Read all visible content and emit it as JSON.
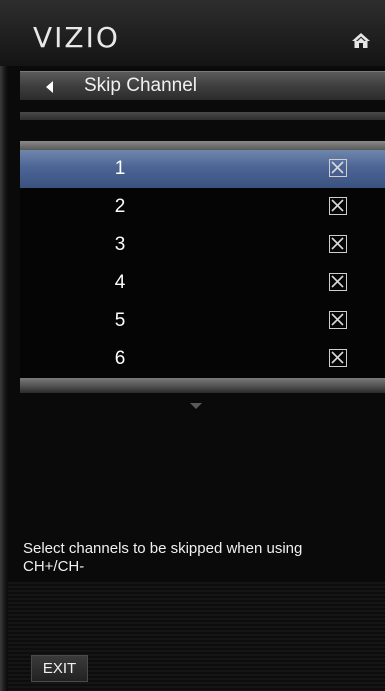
{
  "brand": {
    "logo_text": "VIZIO"
  },
  "header": {
    "home_icon": "home-icon"
  },
  "title_bar": {
    "back_icon": "left-arrow-icon",
    "title": "Skip Channel"
  },
  "channels": [
    {
      "number": "1",
      "skipped": true,
      "selected": true
    },
    {
      "number": "2",
      "skipped": true,
      "selected": false
    },
    {
      "number": "3",
      "skipped": true,
      "selected": false
    },
    {
      "number": "4",
      "skipped": true,
      "selected": false
    },
    {
      "number": "5",
      "skipped": true,
      "selected": false
    },
    {
      "number": "6",
      "skipped": true,
      "selected": false
    }
  ],
  "list": {
    "scroll_icon": "scroll-down-arrow-icon"
  },
  "description": "Select channels to be skipped when using CH+/CH-",
  "footer": {
    "exit_label": "EXIT"
  },
  "colors": {
    "selected_row": "#4d6594",
    "text": "#f0f0f0",
    "background": "#0a0a0a"
  }
}
